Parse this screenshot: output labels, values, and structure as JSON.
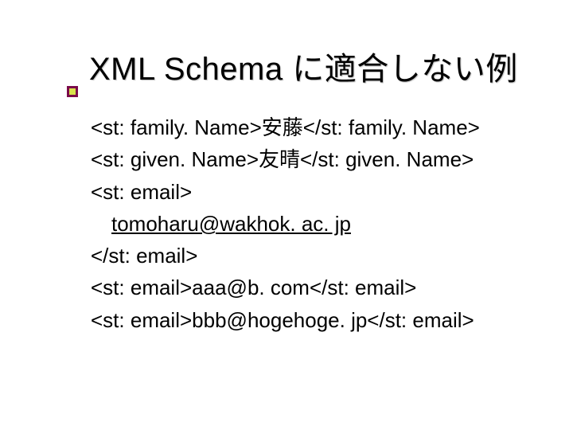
{
  "title": "XML Schema に適合しない例",
  "lines": {
    "l1": "<st: family. Name>安藤</st: family. Name>",
    "l2": "<st: given. Name>友晴</st: given. Name>",
    "l3": "<st: email>",
    "l4_link": "tomoharu@wakhok. ac. jp",
    "l5": "</st: email>",
    "l6": "<st: email>aaa@b. com</st: email>",
    "l7": "<st: email>bbb@hogehoge. jp</st: email>"
  }
}
